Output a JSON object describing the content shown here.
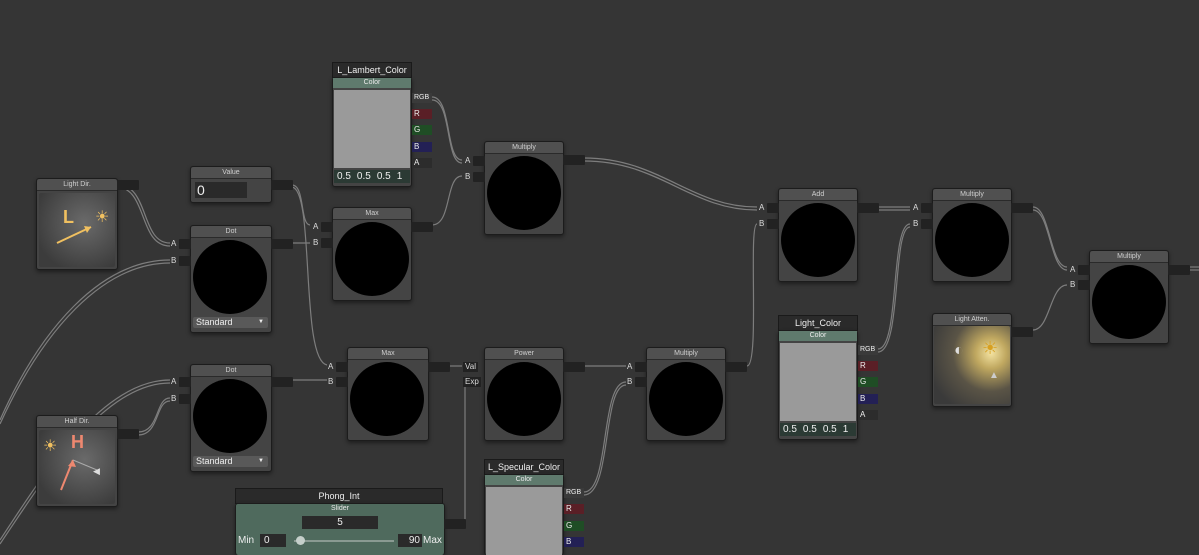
{
  "nodes": {
    "light_dir": {
      "title": "Light Dir.",
      "label_l": "L"
    },
    "half_dir": {
      "title": "Half Dir.",
      "label_h": "H"
    },
    "value": {
      "title": "Value",
      "value": "0"
    },
    "dot1": {
      "title": "Dot",
      "in_a": "A",
      "in_b": "B",
      "mode": "Standard"
    },
    "dot2": {
      "title": "Dot",
      "in_a": "A",
      "in_b": "B",
      "mode": "Standard"
    },
    "max1": {
      "title": "Max",
      "in_a": "A",
      "in_b": "B"
    },
    "max2": {
      "title": "Max",
      "in_a": "A",
      "in_b": "B"
    },
    "lambert": {
      "name": "L_Lambert_Color",
      "header": "Color",
      "out_rgb": "RGB",
      "out_r": "R",
      "out_g": "G",
      "out_b": "B",
      "out_a": "A",
      "v1": "0.5",
      "v2": "0.5",
      "v3": "0.5",
      "v4": "1",
      "swatch": "#9a9a9a"
    },
    "multiply1": {
      "title": "Multiply",
      "in_a": "A",
      "in_b": "B"
    },
    "power": {
      "title": "Power",
      "in_val": "Val",
      "in_exp": "Exp"
    },
    "multiply2": {
      "title": "Multiply",
      "in_a": "A",
      "in_b": "B"
    },
    "add": {
      "title": "Add",
      "in_a": "A",
      "in_b": "B"
    },
    "light_color": {
      "name": "Light_Color",
      "header": "Color",
      "out_rgb": "RGB",
      "out_r": "R",
      "out_g": "G",
      "out_b": "B",
      "out_a": "A",
      "v1": "0.5",
      "v2": "0.5",
      "v3": "0.5",
      "v4": "1",
      "swatch": "#9a9a9a"
    },
    "multiply3": {
      "title": "Multiply",
      "in_a": "A",
      "in_b": "B"
    },
    "light_atten": {
      "title": "Light Atten."
    },
    "multiply4": {
      "title": "Multiply",
      "in_a": "A",
      "in_b": "B"
    },
    "specular": {
      "name": "L_Specular_Color",
      "header": "Color",
      "out_rgb": "RGB",
      "out_r": "R",
      "out_g": "G",
      "out_b": "B",
      "swatch": "#9a9a9a"
    },
    "phong": {
      "name": "Phong_Int",
      "header": "Slider",
      "value": "5",
      "min_label": "Min",
      "min": "0",
      "max": "90",
      "max_label": "Max",
      "slider_fraction": 0.06
    }
  },
  "colors": {
    "canvas": "#353535",
    "node": "#444444",
    "wire": "#8a8a8a",
    "color_header": "#5f7a6d"
  }
}
